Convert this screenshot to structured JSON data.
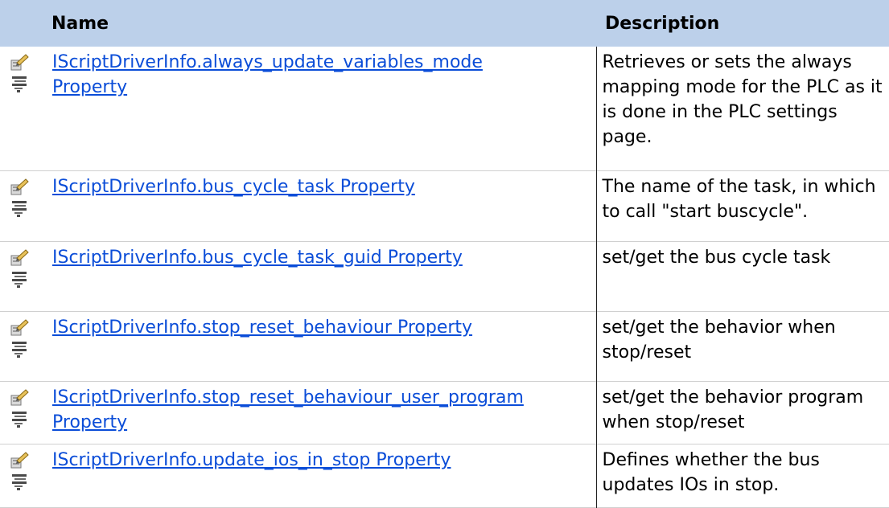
{
  "table": {
    "headers": {
      "name": "Name",
      "description": "Description"
    },
    "rows": [
      {
        "icons": [
          "property-icon",
          "static-member-icon"
        ],
        "name": [
          "IScriptDriverInfo.always_update_variables_mode",
          "Property"
        ],
        "description": "Retrieves or sets the always mapping mode for the PLC as it is done in the PLC settings page."
      },
      {
        "icons": [
          "property-icon",
          "static-member-icon"
        ],
        "name": [
          "IScriptDriverInfo.bus_cycle_task Property"
        ],
        "description": "The name of the task, in which to call \"start buscycle\"."
      },
      {
        "icons": [
          "property-icon",
          "static-member-icon"
        ],
        "name": [
          "IScriptDriverInfo.bus_cycle_task_guid Property"
        ],
        "description": "set/get the bus cycle task"
      },
      {
        "icons": [
          "property-icon",
          "static-member-icon"
        ],
        "name": [
          "IScriptDriverInfo.stop_reset_behaviour Property"
        ],
        "description": "set/get the behavior when stop/reset"
      },
      {
        "icons": [
          "property-icon",
          "static-member-icon"
        ],
        "name": [
          "IScriptDriverInfo.stop_reset_behaviour_user_program",
          "Property"
        ],
        "description": "set/get the behavior program when stop/reset"
      },
      {
        "icons": [
          "property-icon",
          "static-member-icon"
        ],
        "name": [
          "IScriptDriverInfo.update_ios_in_stop Property"
        ],
        "description": "Defines whether the bus updates IOs in stop."
      }
    ]
  },
  "colors": {
    "header_bg": "#bcd0ea",
    "link": "#0b4dd8"
  }
}
